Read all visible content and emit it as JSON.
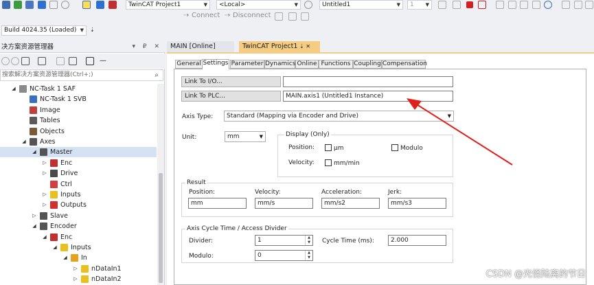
{
  "toolbar": {
    "project_combo": "TwinCAT Project1",
    "target_combo": "<Local>",
    "config_combo": "Untitled1",
    "num_combo": "1",
    "connect_label": "Connect",
    "disconnect_label": "Disconnect",
    "build_combo": "Build 4024.35 (Loaded)"
  },
  "solution_explorer": {
    "title": "决方案资源管理器",
    "pin_buttons": "▾ ₽ ✕",
    "search_placeholder": "搜索解决方案资源管理器(Ctrl+;)",
    "tree": [
      {
        "label": "NC-Task 1 SAF",
        "level": 0,
        "toggle": "◢",
        "icon": "#8a8a8a",
        "sel": false
      },
      {
        "label": "NC-Task 1 SVB",
        "level": 1,
        "toggle": "",
        "icon": "#3a6fc0",
        "sel": false
      },
      {
        "label": "Image",
        "level": 1,
        "toggle": "",
        "icon": "#c04040",
        "sel": false
      },
      {
        "label": "Tables",
        "level": 1,
        "toggle": "",
        "icon": "#5a5a5a",
        "sel": false
      },
      {
        "label": "Objects",
        "level": 1,
        "toggle": "",
        "icon": "#7a5a3a",
        "sel": false
      },
      {
        "label": "Axes",
        "level": 1,
        "toggle": "◢",
        "icon": "#555",
        "sel": false
      },
      {
        "label": "Master",
        "level": 2,
        "toggle": "◢",
        "icon": "#555",
        "sel": true
      },
      {
        "label": "Enc",
        "level": 3,
        "toggle": "▷",
        "icon": "#c03030",
        "sel": false
      },
      {
        "label": "Drive",
        "level": 3,
        "toggle": "▷",
        "icon": "#4a4a4a",
        "sel": false
      },
      {
        "label": "Ctrl",
        "level": 3,
        "toggle": "",
        "icon": "#d04040",
        "sel": false
      },
      {
        "label": "Inputs",
        "level": 3,
        "toggle": "▷",
        "icon": "#e8c020",
        "sel": false
      },
      {
        "label": "Outputs",
        "level": 3,
        "toggle": "▷",
        "icon": "#d03030",
        "sel": false
      },
      {
        "label": "Slave",
        "level": 2,
        "toggle": "▷",
        "icon": "#555",
        "sel": false
      },
      {
        "label": "Encoder",
        "level": 2,
        "toggle": "◢",
        "icon": "#555",
        "sel": false
      },
      {
        "label": "Enc",
        "level": 3,
        "toggle": "◢",
        "icon": "#c03030",
        "sel": false
      },
      {
        "label": "Inputs",
        "level": 4,
        "toggle": "◢",
        "icon": "#e8c020",
        "sel": false
      },
      {
        "label": "In",
        "level": 5,
        "toggle": "◢",
        "icon": "#e8a020",
        "sel": false
      },
      {
        "label": "nDataIn1",
        "level": 6,
        "toggle": "▷",
        "icon": "#e8c020",
        "sel": false
      },
      {
        "label": "nDataIn2",
        "level": 6,
        "toggle": "▷",
        "icon": "#e8c020",
        "sel": false
      }
    ]
  },
  "doc_tabs": [
    {
      "label": "MAIN [Online]",
      "active": false
    },
    {
      "label": "TwinCAT Project1",
      "active": true,
      "pin": "⇣ ✕"
    }
  ],
  "prop_tabs": [
    "General",
    "Settings",
    "Parameter",
    "Dynamics",
    "Online",
    "Functions",
    "Coupling",
    "Compensation"
  ],
  "active_prop_tab": "Settings",
  "settings": {
    "link_io_label": "Link To I/O...",
    "link_io_value": "",
    "link_plc_label": "Link To PLC...",
    "link_plc_value": "MAIN.axis1 (Untitled1 Instance)",
    "axis_type_label": "Axis Type:",
    "axis_type_value": "Standard (Mapping via Encoder and Drive)",
    "unit_label": "Unit:",
    "unit_value": "mm",
    "display_group": "Display (Only)",
    "position_label": "Position:",
    "um_label": "µm",
    "modulo_label": "Modulo",
    "velocity_label": "Velocity:",
    "mm_min_label": "mm/min",
    "result_group": "Result",
    "res_position_label": "Position:",
    "res_velocity_label": "Velocity:",
    "res_accel_label": "Acceleration:",
    "res_jerk_label": "Jerk:",
    "res_position_value": "mm",
    "res_velocity_value": "mm/s",
    "res_accel_value": "mm/s2",
    "res_jerk_value": "mm/s3",
    "cycle_group": "Axis Cycle Time / Access Divider",
    "divider_label": "Divider:",
    "divider_value": "1",
    "cycle_time_label": "Cycle Time (ms):",
    "cycle_time_value": "2.000",
    "modulo2_label": "Modulo:",
    "modulo2_value": "0"
  },
  "annotation_color": "#e0201c",
  "watermark": "CSDN @光怪陆离的节日"
}
